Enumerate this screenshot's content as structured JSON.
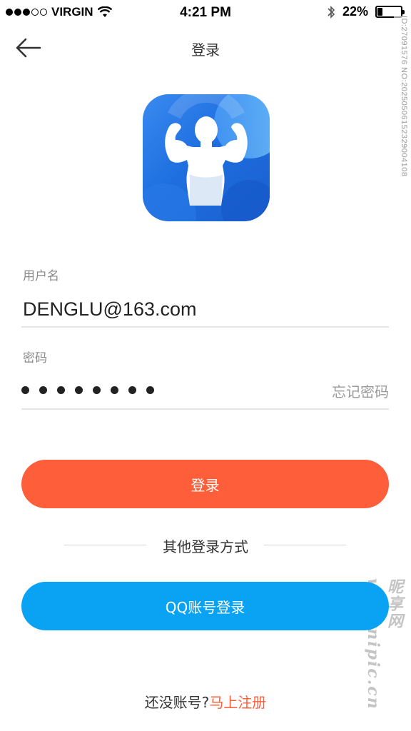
{
  "status_bar": {
    "carrier": "VIRGIN",
    "time": "4:21 PM",
    "battery_percent": "22%",
    "battery_level": 0.22
  },
  "watermark": {
    "id_text": "ID:27091576 NO:20250506152329004108",
    "site_text": "昵享网 www.nipic.cn"
  },
  "nav": {
    "back_icon": "arrow-left-icon",
    "title": "登录"
  },
  "app_icon": {
    "icon": "bodybuilder-icon"
  },
  "form": {
    "username_label": "用户名",
    "username_value": "DENGLU@163.com",
    "password_label": "密码",
    "password_length": 8,
    "forgot_label": "忘记密码"
  },
  "buttons": {
    "login_label": "登录",
    "qq_login_label": "QQ账号登录"
  },
  "divider_text": "其他登录方式",
  "register": {
    "prompt": "还没账号?",
    "link": "马上注册"
  },
  "colors": {
    "accent_orange": "#ff5e3a",
    "qq_blue": "#0aa3f3",
    "icon_blue": "#1e6fe0"
  }
}
